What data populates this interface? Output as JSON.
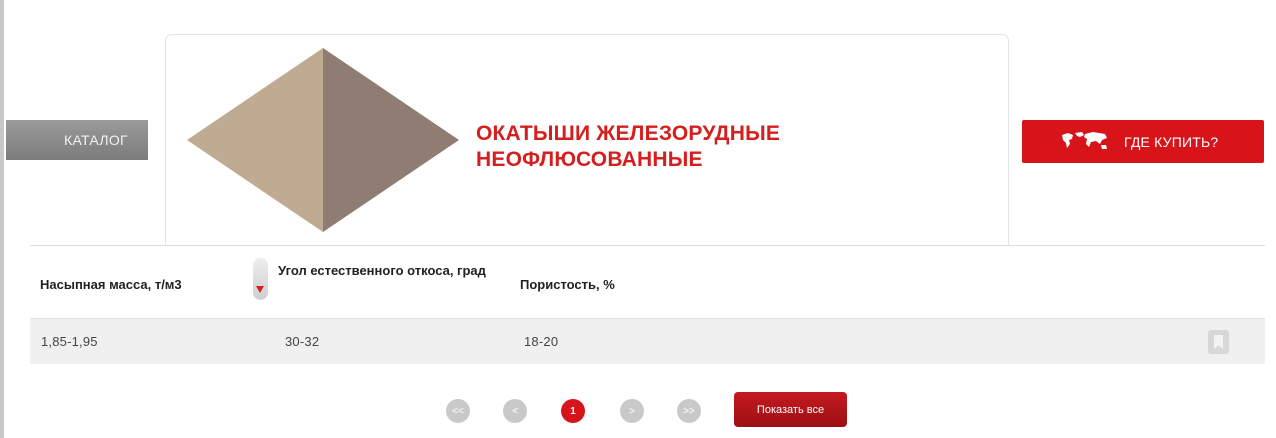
{
  "nav": {
    "catalog_label": "КАТАЛОГ"
  },
  "product": {
    "title_line1": "ОКАТЫШИ ЖЕЛЕЗОРУДНЫЕ",
    "title_line2": "НЕОФЛЮСОВАННЫЕ"
  },
  "buy": {
    "label": "ГДЕ КУПИТЬ?",
    "icon": "world-map-icon"
  },
  "table": {
    "headers": {
      "mass": "Насыпная масса, т/м3",
      "angle": "Угол естественного откоса, град",
      "porosity": "Пористость, %"
    },
    "rows": [
      {
        "mass": "1,85-1,95",
        "angle": "30-32",
        "porosity": "18-20"
      }
    ]
  },
  "pagination": {
    "first": "<<",
    "prev": "<",
    "current": "1",
    "next": ">",
    "last": ">>",
    "show_all": "Показать все"
  },
  "colors": {
    "accent": "#d8141b",
    "title": "#d61e1e",
    "pyramid_light": "#bfab92",
    "pyramid_dark": "#8f7d73",
    "tab": "#8a8a8a"
  }
}
